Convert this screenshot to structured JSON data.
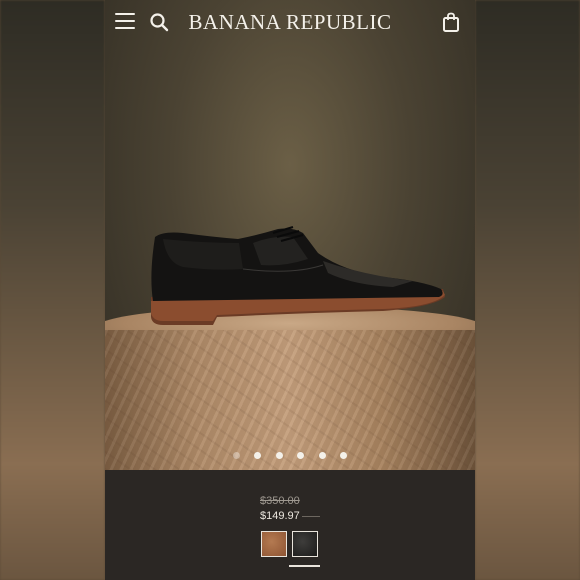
{
  "header": {
    "brand": "BANANA REPUBLIC",
    "icons": [
      "menu-icon",
      "search-icon",
      "shopping-bag-icon"
    ]
  },
  "carousel": {
    "dot_count": 6,
    "active_dot": 1
  },
  "product": {
    "original_price": "$350.00",
    "sale_price": "$149.97",
    "swatches": [
      {
        "name": "brown",
        "color": "#9a6240",
        "selected": false
      },
      {
        "name": "black",
        "color": "#2a2928",
        "selected": true
      }
    ]
  },
  "colors": {
    "header_text": "#f4f1ea",
    "bottom_bg": "#2b2724"
  }
}
